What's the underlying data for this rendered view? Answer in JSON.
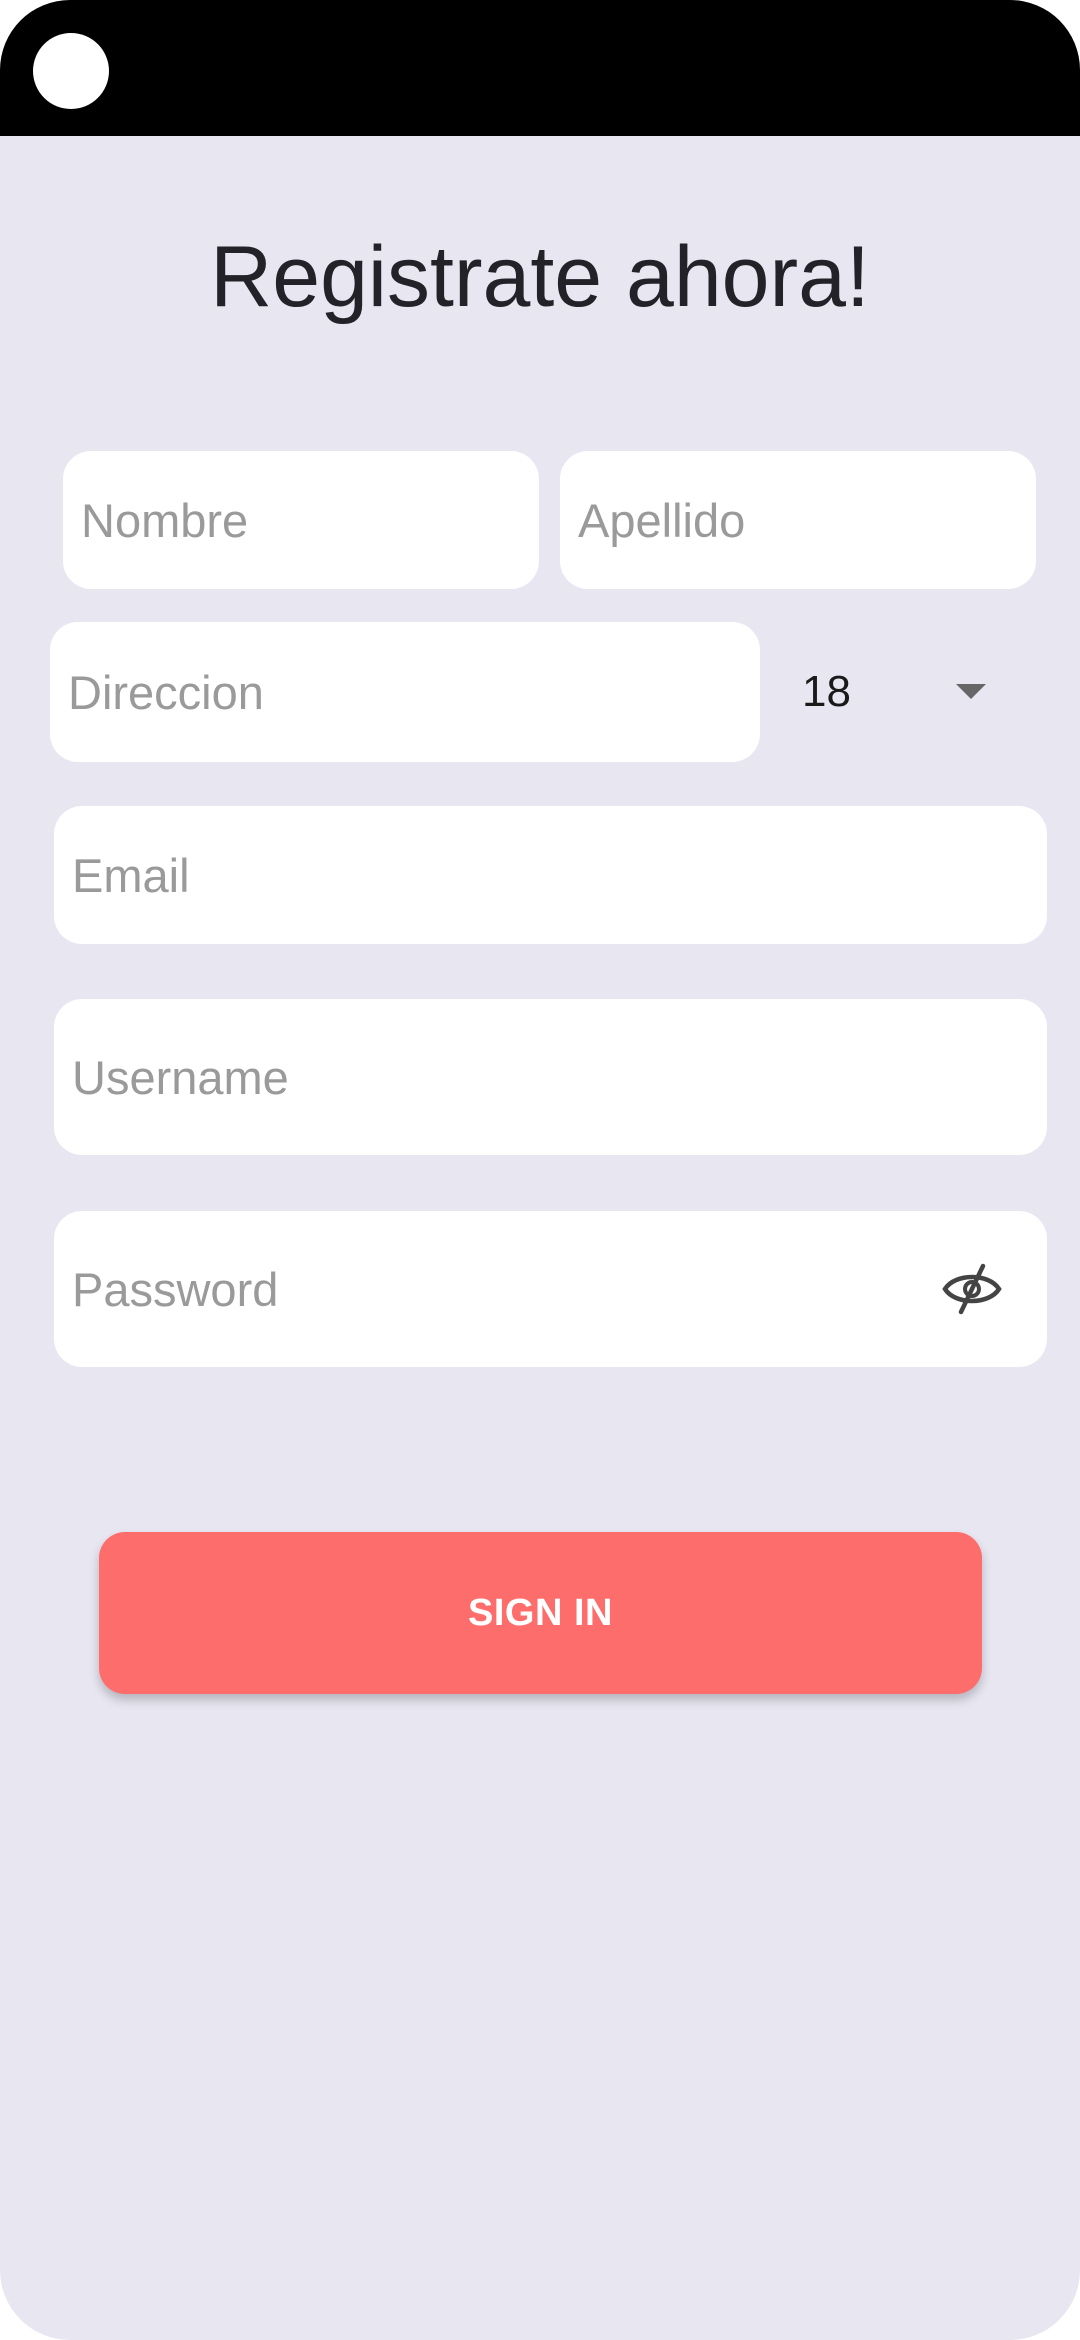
{
  "form": {
    "title": "Registrate ahora!",
    "nombre_placeholder": "Nombre",
    "apellido_placeholder": "Apellido",
    "direccion_placeholder": "Direccion",
    "age_value": "18",
    "email_placeholder": "Email",
    "username_placeholder": "Username",
    "password_placeholder": "Password",
    "password_toggle_icon": "eye-off-icon",
    "age_dropdown_icon": "chevron-down-icon",
    "signin_label": "SIGN IN"
  },
  "colors": {
    "background": "#e8e6f1",
    "status_bar": "#000000",
    "field_bg": "#ffffff",
    "placeholder": "#9a9a9a",
    "button": "#fd6d6c",
    "button_text": "#ffffff",
    "title_text": "#222228"
  }
}
